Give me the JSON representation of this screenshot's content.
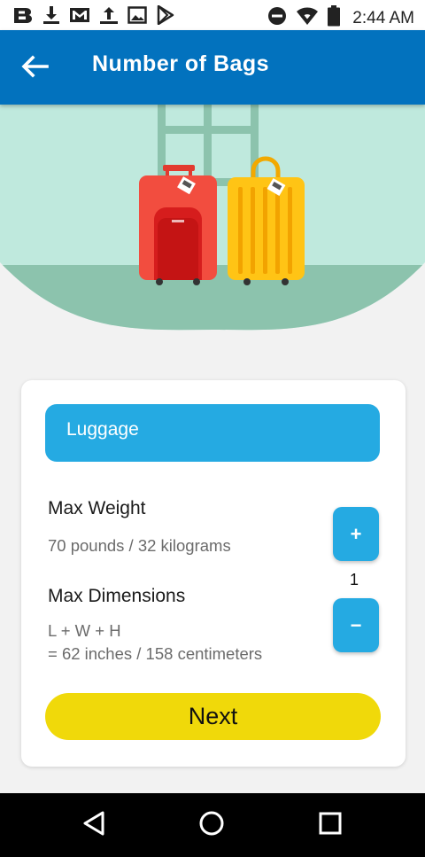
{
  "status_bar": {
    "time": "2:44 AM",
    "left_icons": [
      "b-app-icon",
      "download-icon",
      "gmail-icon",
      "upload-icon",
      "image-icon",
      "play-store-icon"
    ],
    "right_icons": [
      "do-not-disturb-icon",
      "wifi-icon",
      "battery-icon"
    ]
  },
  "app_bar": {
    "title": "Number of Bags",
    "back_icon": "arrow-left-icon"
  },
  "card": {
    "header_label": "Luggage",
    "max_weight_label": "Max Weight",
    "max_weight_value": "70 pounds / 32 kilograms",
    "max_dimensions_label": "Max Dimensions",
    "max_dimensions_formula": "L + W + H",
    "max_dimensions_value": "= 62 inches / 158 centimeters",
    "increment_label": "+",
    "decrement_label": "−",
    "bag_count": "1",
    "next_label": "Next"
  },
  "nav_bar": {
    "icons": [
      "back-triangle-icon",
      "home-circle-icon",
      "recents-square-icon"
    ]
  },
  "colors": {
    "app_bar": "#0272be",
    "accent_blue": "#25aae2",
    "next_button": "#f0d90a",
    "hero_background": "#bfe9dd",
    "hero_floor": "#8cc3ad",
    "red_suitcase": "#f24d3f",
    "yellow_suitcase": "#ffc415"
  }
}
